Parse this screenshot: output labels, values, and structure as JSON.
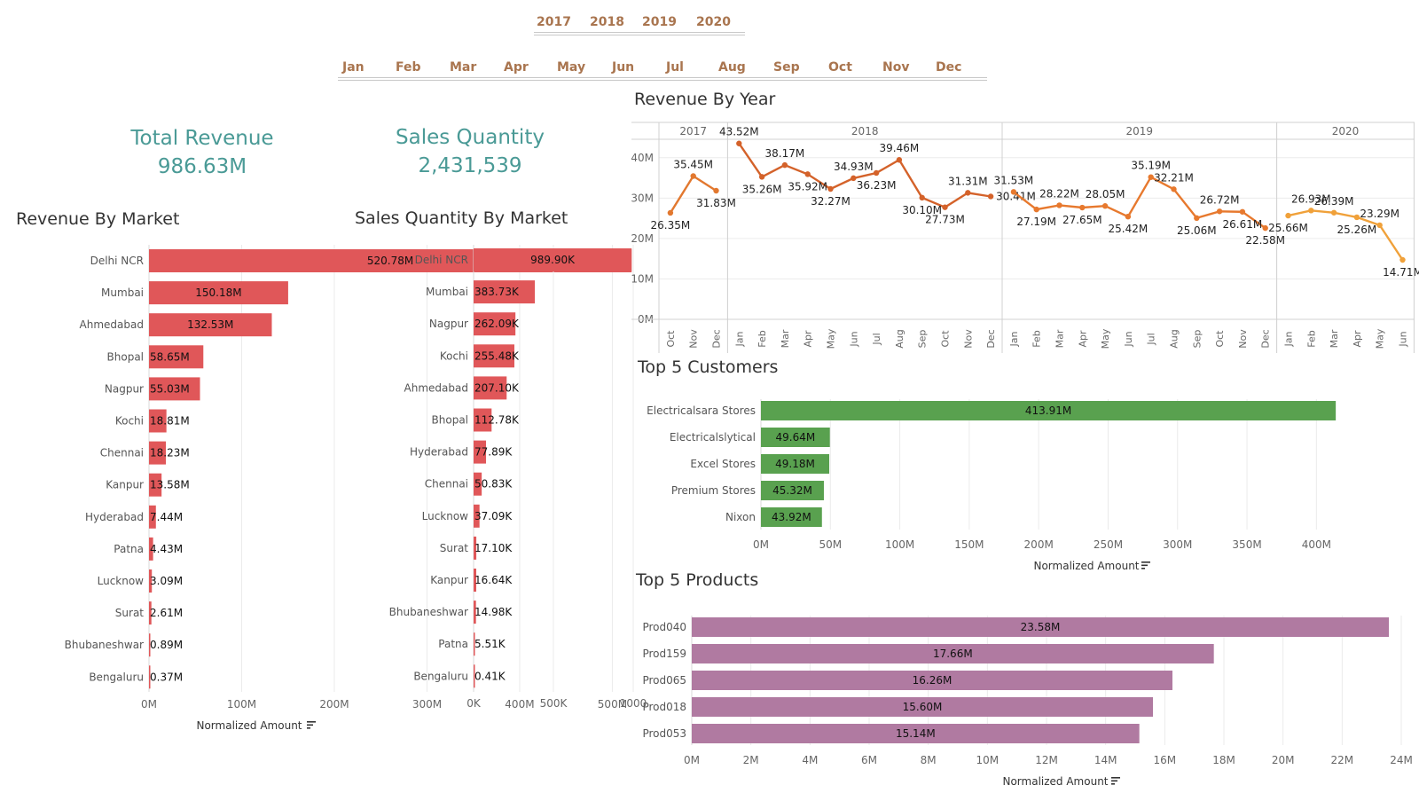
{
  "filters": {
    "years": [
      "2017",
      "2018",
      "2019",
      "2020"
    ],
    "months": [
      "Jan",
      "Feb",
      "Mar",
      "Apr",
      "May",
      "Jun",
      "Jul",
      "Aug",
      "Sep",
      "Oct",
      "Nov",
      "Dec"
    ]
  },
  "kpis": {
    "total_revenue": {
      "label": "Total Revenue",
      "value": "986.63M"
    },
    "sales_quantity": {
      "label": "Sales Quantity",
      "value": "2,431,539"
    }
  },
  "colors": {
    "kpi": "#4a9a96",
    "market_bar": "#e05759",
    "customer_bar": "#59a14f",
    "product_bar": "#b07aa1",
    "filter_text": "#a9754f",
    "line_2017": "#e2782f",
    "line_2018": "#d4622a",
    "line_2019": "#e7792e",
    "line_2020": "#f0a13a"
  },
  "chart_data": [
    {
      "id": "revenue_by_market",
      "type": "bar",
      "orientation": "horizontal",
      "title": "Revenue By Market",
      "xlabel": "Normalized Amount",
      "categories": [
        "Delhi NCR",
        "Mumbai",
        "Ahmedabad",
        "Bhopal",
        "Nagpur",
        "Kochi",
        "Chennai",
        "Kanpur",
        "Hyderabad",
        "Patna",
        "Lucknow",
        "Surat",
        "Bhubaneshwar",
        "Bengaluru"
      ],
      "values": [
        520.78,
        150.18,
        132.53,
        58.65,
        55.03,
        18.81,
        18.23,
        13.58,
        7.44,
        4.43,
        3.09,
        2.61,
        0.89,
        0.37
      ],
      "unit": "M",
      "labels": [
        "520.78M",
        "150.18M",
        "132.53M",
        "58.65M",
        "55.03M",
        "18.81M",
        "18.23M",
        "13.58M",
        "7.44M",
        "4.43M",
        "3.09M",
        "2.61M",
        "0.89M",
        "0.37M"
      ],
      "xticks": [
        "0M",
        "100M",
        "200M",
        "300M",
        "400M",
        "500M"
      ],
      "tick_values": [
        0,
        100,
        200,
        300,
        400,
        500
      ],
      "xlim": [
        0,
        535
      ],
      "grid": true
    },
    {
      "id": "sales_quantity_by_market",
      "type": "bar",
      "orientation": "horizontal",
      "title": "Sales Quantity By Market",
      "categories": [
        "Delhi NCR",
        "Mumbai",
        "Nagpur",
        "Kochi",
        "Ahmedabad",
        "Bhopal",
        "Hyderabad",
        "Chennai",
        "Lucknow",
        "Surat",
        "Kanpur",
        "Bhubaneshwar",
        "Patna",
        "Bengaluru"
      ],
      "values": [
        989.9,
        383.73,
        262.09,
        255.48,
        207.1,
        112.78,
        77.89,
        50.83,
        37.09,
        17.1,
        16.64,
        14.98,
        5.51,
        0.41
      ],
      "unit": "K",
      "labels": [
        "989.90K",
        "383.73K",
        "262.09K",
        "255.48K",
        "207.10K",
        "112.78K",
        "77.89K",
        "50.83K",
        "37.09K",
        "17.10K",
        "16.64K",
        "14.98K",
        "5.51K",
        "0.41K"
      ],
      "xticks": [
        "0K",
        "500K",
        "1000"
      ],
      "tick_values": [
        0,
        500,
        1000
      ],
      "xlim": [
        0,
        1000
      ],
      "grid": true
    },
    {
      "id": "revenue_by_year",
      "type": "line",
      "title": "Revenue By Year",
      "yticks": [
        "0M",
        "10M",
        "20M",
        "30M",
        "40M"
      ],
      "ytick_values": [
        0,
        10,
        20,
        30,
        40
      ],
      "ylim": [
        0,
        45
      ],
      "grid": true,
      "panels": [
        {
          "year": "2017",
          "months": [
            "Oct",
            "Nov",
            "Dec"
          ],
          "values": [
            26.35,
            35.45,
            31.83
          ],
          "labels": [
            "26.35M",
            "35.45M",
            "31.83M"
          ]
        },
        {
          "year": "2018",
          "months": [
            "Jan",
            "Feb",
            "Mar",
            "Apr",
            "May",
            "Jun",
            "Jul",
            "Aug",
            "Sep",
            "Oct",
            "Nov",
            "Dec"
          ],
          "values": [
            43.52,
            35.26,
            38.17,
            35.92,
            32.27,
            34.93,
            36.23,
            39.46,
            30.1,
            27.73,
            31.31,
            30.41
          ],
          "labels": [
            "43.52M",
            "35.26M",
            "38.17M",
            "35.92M",
            "32.27M",
            "34.93M",
            "36.23M",
            "39.46M",
            "30.10M",
            "27.73M",
            "31.31M",
            "30.41M"
          ]
        },
        {
          "year": "2019",
          "months": [
            "Jan",
            "Feb",
            "Mar",
            "Apr",
            "May",
            "Jun",
            "Jul",
            "Aug",
            "Sep",
            "Oct",
            "Nov",
            "Dec"
          ],
          "values": [
            31.53,
            27.19,
            28.22,
            27.65,
            28.05,
            25.42,
            35.19,
            32.21,
            25.06,
            26.72,
            26.61,
            22.58
          ],
          "labels": [
            "31.53M",
            "27.19M",
            "28.22M",
            "27.65M",
            "28.05M",
            "25.42M",
            "35.19M",
            "32.21M",
            "25.06M",
            "26.72M",
            "26.61M",
            "22.58M"
          ]
        },
        {
          "year": "2020",
          "months": [
            "Jan",
            "Feb",
            "Mar",
            "Apr",
            "May",
            "Jun"
          ],
          "values": [
            25.66,
            26.93,
            26.39,
            25.26,
            23.29,
            14.71
          ],
          "labels": [
            "25.66M",
            "26.93M",
            "26.39M",
            "25.26M",
            "23.29M",
            "14.71M"
          ]
        }
      ]
    },
    {
      "id": "top5_customers",
      "type": "bar",
      "orientation": "horizontal",
      "title": "Top 5 Customers",
      "xlabel": "Normalized Amount",
      "categories": [
        "Electricalsara Stores",
        "Electricalslytical",
        "Excel Stores",
        "Premium Stores",
        "Nixon"
      ],
      "values": [
        413.91,
        49.64,
        49.18,
        45.32,
        43.92
      ],
      "unit": "M",
      "labels": [
        "413.91M",
        "49.64M",
        "49.18M",
        "45.32M",
        "43.92M"
      ],
      "xticks": [
        "0M",
        "50M",
        "100M",
        "150M",
        "200M",
        "250M",
        "300M",
        "350M",
        "400M"
      ],
      "tick_values": [
        0,
        50,
        100,
        150,
        200,
        250,
        300,
        350,
        400
      ],
      "xlim": [
        0,
        440
      ],
      "grid": true
    },
    {
      "id": "top5_products",
      "type": "bar",
      "orientation": "horizontal",
      "title": "Top 5 Products",
      "xlabel": "Normalized Amount",
      "categories": [
        "Prod040",
        "Prod159",
        "Prod065",
        "Prod018",
        "Prod053"
      ],
      "values": [
        23.58,
        17.66,
        16.26,
        15.6,
        15.14
      ],
      "unit": "M",
      "labels": [
        "23.58M",
        "17.66M",
        "16.26M",
        "15.60M",
        "15.14M"
      ],
      "xticks": [
        "0M",
        "2M",
        "4M",
        "6M",
        "8M",
        "10M",
        "12M",
        "14M",
        "16M",
        "18M",
        "20M",
        "22M",
        "24M"
      ],
      "tick_values": [
        0,
        2,
        4,
        6,
        8,
        10,
        12,
        14,
        16,
        18,
        20,
        22,
        24
      ],
      "xlim": [
        0,
        24
      ],
      "grid": true
    }
  ]
}
